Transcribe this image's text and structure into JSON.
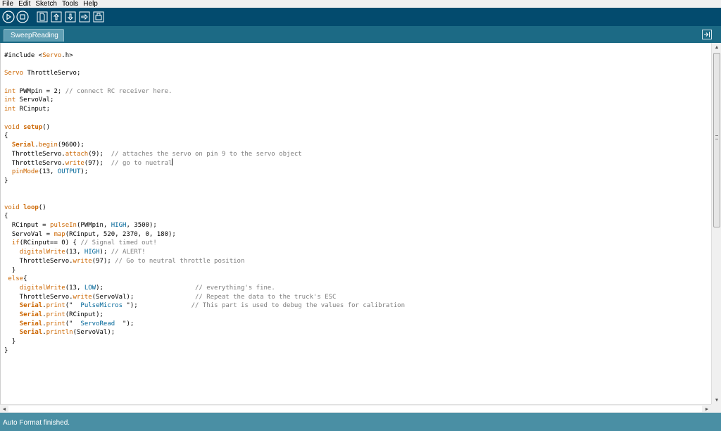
{
  "menu": {
    "items": [
      "File",
      "Edit",
      "Sketch",
      "Tools",
      "Help"
    ]
  },
  "toolbar": {
    "buttons": [
      "verify-icon",
      "stop-icon",
      "new-icon",
      "open-icon",
      "save-icon",
      "upload-icon",
      "serial-monitor-icon"
    ]
  },
  "tabs": {
    "active_label": "SweepReading §"
  },
  "editor": {
    "lines": [
      [
        [
          "#include <",
          ""
        ],
        [
          "Servo",
          "kw"
        ],
        [
          ".h>",
          ""
        ]
      ],
      [],
      [
        [
          "Servo",
          "kw"
        ],
        [
          " ThrottleServo;",
          ""
        ]
      ],
      [],
      [
        [
          "int",
          "kw"
        ],
        [
          " PWMpin = 2; ",
          ""
        ],
        [
          "// connect RC receiver here.",
          "cmt"
        ]
      ],
      [
        [
          "int",
          "kw"
        ],
        [
          " ServoVal;",
          ""
        ]
      ],
      [
        [
          "int",
          "kw"
        ],
        [
          " RCinput;",
          ""
        ]
      ],
      [],
      [
        [
          "void",
          "kw"
        ],
        [
          " ",
          ""
        ],
        [
          "setup",
          "fnb"
        ],
        [
          "()",
          ""
        ]
      ],
      [
        [
          "{",
          ""
        ]
      ],
      [
        [
          "  ",
          ""
        ],
        [
          "Serial",
          "fnb"
        ],
        [
          ".",
          ""
        ],
        [
          "begin",
          "fn"
        ],
        [
          "(9600);",
          ""
        ]
      ],
      [
        [
          "  ThrottleServo.",
          ""
        ],
        [
          "attach",
          "fn"
        ],
        [
          "(9);  ",
          ""
        ],
        [
          "// attaches the servo on pin 9 to the servo object",
          "cmt"
        ]
      ],
      [
        [
          "  ThrottleServo.",
          ""
        ],
        [
          "write",
          "fn"
        ],
        [
          "(97);  ",
          ""
        ],
        [
          "// go to nuetral",
          "cmt"
        ],
        [
          "",
          "cursor"
        ]
      ],
      [
        [
          "  ",
          ""
        ],
        [
          "pinMode",
          "fn"
        ],
        [
          "(13, ",
          ""
        ],
        [
          "OUTPUT",
          "cst"
        ],
        [
          ");",
          ""
        ]
      ],
      [
        [
          "}",
          ""
        ]
      ],
      [],
      [],
      [
        [
          "void",
          "kw"
        ],
        [
          " ",
          ""
        ],
        [
          "loop",
          "fnb"
        ],
        [
          "()",
          ""
        ]
      ],
      [
        [
          "{",
          ""
        ]
      ],
      [
        [
          "  RCinput = ",
          ""
        ],
        [
          "pulseIn",
          "fn"
        ],
        [
          "(PWMpin, ",
          ""
        ],
        [
          "HIGH",
          "cst"
        ],
        [
          ", 3500);",
          ""
        ]
      ],
      [
        [
          "  ServoVal = ",
          ""
        ],
        [
          "map",
          "fn"
        ],
        [
          "(RCinput, 520, 2370, 0, 180);",
          ""
        ]
      ],
      [
        [
          "  ",
          ""
        ],
        [
          "if",
          "kw"
        ],
        [
          "(RCinput== 0) { ",
          ""
        ],
        [
          "// Signal timed out!",
          "cmt"
        ]
      ],
      [
        [
          "    ",
          ""
        ],
        [
          "digitalWrite",
          "fn"
        ],
        [
          "(13, ",
          ""
        ],
        [
          "HIGH",
          "cst"
        ],
        [
          "); ",
          ""
        ],
        [
          "// ALERT!",
          "cmt"
        ]
      ],
      [
        [
          "    ThrottleServo.",
          ""
        ],
        [
          "write",
          "fn"
        ],
        [
          "(97); ",
          ""
        ],
        [
          "// Go to neutral throttle position",
          "cmt"
        ]
      ],
      [
        [
          "  }",
          ""
        ]
      ],
      [
        [
          " ",
          ""
        ],
        [
          "else",
          "kw"
        ],
        [
          "{",
          ""
        ]
      ],
      [
        [
          "    ",
          ""
        ],
        [
          "digitalWrite",
          "fn"
        ],
        [
          "(13, ",
          ""
        ],
        [
          "LOW",
          "cst"
        ],
        [
          ");                        ",
          ""
        ],
        [
          "// everything's fine.",
          "cmt"
        ]
      ],
      [
        [
          "    ThrottleServo.",
          ""
        ],
        [
          "write",
          "fn"
        ],
        [
          "(ServoVal);                ",
          ""
        ],
        [
          "// Repeat the data to the truck's ESC",
          "cmt"
        ]
      ],
      [
        [
          "    ",
          ""
        ],
        [
          "Serial",
          "fnb"
        ],
        [
          ".",
          ""
        ],
        [
          "print",
          "fn"
        ],
        [
          "(\"  ",
          ""
        ],
        [
          "PulseMicros",
          "cst"
        ],
        [
          " \");              ",
          ""
        ],
        [
          "// This part is used to debug the values for calibration",
          "cmt"
        ]
      ],
      [
        [
          "    ",
          ""
        ],
        [
          "Serial",
          "fnb"
        ],
        [
          ".",
          ""
        ],
        [
          "print",
          "fn"
        ],
        [
          "(RCinput);",
          ""
        ]
      ],
      [
        [
          "    ",
          ""
        ],
        [
          "Serial",
          "fnb"
        ],
        [
          ".",
          ""
        ],
        [
          "print",
          "fn"
        ],
        [
          "(\"  ",
          ""
        ],
        [
          "ServoRead",
          "cst"
        ],
        [
          "  \");",
          ""
        ]
      ],
      [
        [
          "    ",
          ""
        ],
        [
          "Serial",
          "fnb"
        ],
        [
          ".",
          ""
        ],
        [
          "println",
          "fn"
        ],
        [
          "(ServoVal);",
          ""
        ]
      ],
      [
        [
          "  }",
          ""
        ]
      ],
      [
        [
          "}",
          ""
        ]
      ]
    ]
  },
  "status": {
    "message": "Auto Format finished."
  },
  "colors": {
    "toolbar_bg": "#034b6e",
    "tabbar_bg": "#1c6a85",
    "status_bg": "#4a8fa4",
    "keyword": "#cc6600",
    "constant": "#006699",
    "comment": "#7e7e7e"
  }
}
